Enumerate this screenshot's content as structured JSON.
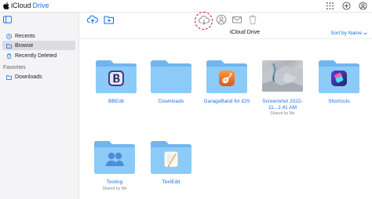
{
  "header": {
    "app_name": "iCloud",
    "product_name": "Drive"
  },
  "sidebar": {
    "items": [
      {
        "label": "Recents",
        "icon": "clock-icon"
      },
      {
        "label": "Browse",
        "icon": "folder-icon",
        "active": true
      },
      {
        "label": "Recently Deleted",
        "icon": "trash-icon"
      }
    ],
    "favorites_label": "Favorites",
    "favorites": [
      {
        "label": "Downloads",
        "icon": "folder-icon"
      }
    ]
  },
  "toolbar": {
    "buttons": [
      "upload-icon",
      "new-folder-icon",
      "download-icon",
      "share-person-icon",
      "mail-icon",
      "trash-icon"
    ],
    "highlighted": "download-icon",
    "highlight_color": "#d0021b"
  },
  "content": {
    "title": "iCloud Drive",
    "sort_label": "Sort by Name",
    "accent_color": "#1a73e8",
    "items": [
      {
        "name": "BBEdit",
        "kind": "app-folder"
      },
      {
        "name": "Downloads",
        "kind": "folder"
      },
      {
        "name": "GarageBand for iOS",
        "kind": "app-folder"
      },
      {
        "name": "Screenshot 2022-11...2.41 AM",
        "sub": "Shared by Me",
        "kind": "image"
      },
      {
        "name": "Shortcuts",
        "kind": "app-folder"
      },
      {
        "name": "Testing",
        "sub": "Shared by Me",
        "kind": "shared-folder"
      },
      {
        "name": "TextEdit",
        "kind": "app-folder"
      }
    ]
  }
}
